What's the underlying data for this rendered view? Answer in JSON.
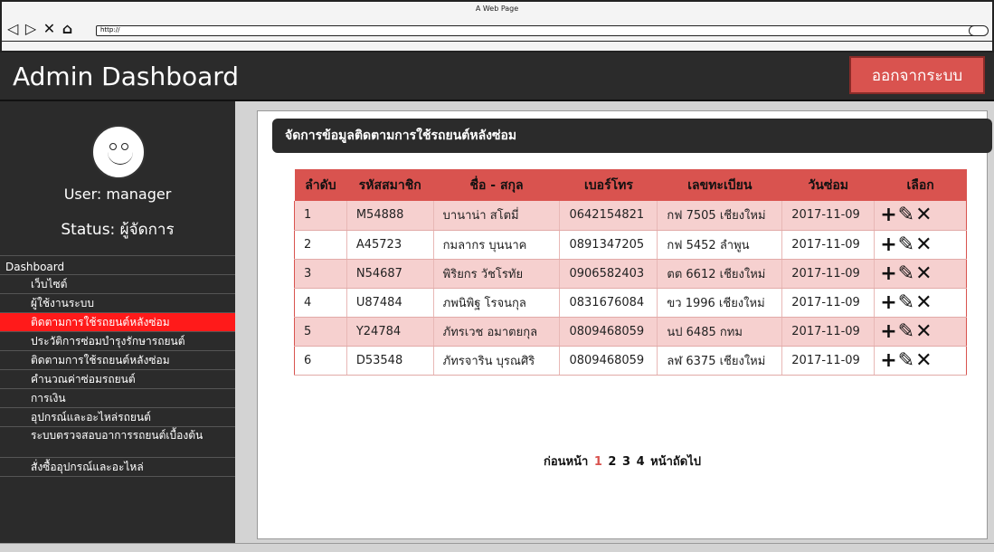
{
  "browser": {
    "window_title": "A Web Page",
    "nav_icons": "◁ ▷ ✕ ⌂",
    "url": "http://"
  },
  "header": {
    "title": "Admin Dashboard",
    "logout_label": "ออกจากระบบ"
  },
  "user": {
    "name_line": "User: manager",
    "status_line": "Status: ผู้จัดการ"
  },
  "sidebar": {
    "section_label": "Dashboard",
    "items": [
      {
        "label": "เว็บไซต์"
      },
      {
        "label": "ผู้ใช้งานระบบ"
      },
      {
        "label": "ติดตามการใช้รถยนต์หลังซ่อม"
      },
      {
        "label": "ประวัติการซ่อมบำรุงรักษารถยนต์"
      },
      {
        "label": "ติดตามการใช้รถยนต์หลังซ่อม"
      },
      {
        "label": "คำนวณค่าซ่อมรถยนต์"
      },
      {
        "label": "การเงิน"
      },
      {
        "label": "อุปกรณ์และอะไหล่รถยนต์"
      },
      {
        "label": "ระบบตรวจสอบอาการรถยนต์เบื้องต้น"
      },
      {
        "label": "สั่งซื้ออุปกรณ์และอะไหล่"
      }
    ]
  },
  "main": {
    "section_title": "จัดการข้อมูลติดตามการใช้รถยนต์หลังซ่อม",
    "table": {
      "headers": [
        "ลำดับ",
        "รหัสสมาชิก",
        "ชื่อ - สกุล",
        "เบอร์โทร",
        "เลขทะเบียน",
        "วันซ่อม",
        "เลือก"
      ],
      "rows": [
        [
          "1",
          "M54888",
          "บานาน่า สโตมี่",
          "0642154821",
          "กฟ 7505 เชียงใหม่",
          "2017-11-09"
        ],
        [
          "2",
          "A45723",
          "กมลากร บุนนาค",
          "0891347205",
          "กฟ 5452 ลำพูน",
          "2017-11-09"
        ],
        [
          "3",
          "N54687",
          "พิริยกร วัชโรทัย",
          "0906582403",
          "ตต 6612 เชียงใหม่",
          "2017-11-09"
        ],
        [
          "4",
          "U87484",
          "ภพนิพิฐ โรจนกุล",
          "0831676084",
          "ขว 1996 เชียงใหม่",
          "2017-11-09"
        ],
        [
          "5",
          "Y24784",
          "ภัทรเวช อมาตยกุล",
          "0809468059",
          "นป 6485 กทม",
          "2017-11-09"
        ],
        [
          "6",
          "D53548",
          "ภัทรจาริน บุรณศิริ",
          "0809468059",
          "ลฬ 6375 เชียงใหม่",
          "2017-11-09"
        ]
      ],
      "action_icons": {
        "add": "+",
        "edit": "✎",
        "delete": "✕"
      }
    },
    "pager": {
      "prev_label": "ก่อนหน้า",
      "pages": [
        "1",
        "2",
        "3",
        "4"
      ],
      "current_page": "1",
      "next_label": "หน้าถัดไป"
    }
  },
  "colors": {
    "accent": "#d9534f",
    "active_nav": "#ff1a1a",
    "dark": "#2b2b2b"
  }
}
